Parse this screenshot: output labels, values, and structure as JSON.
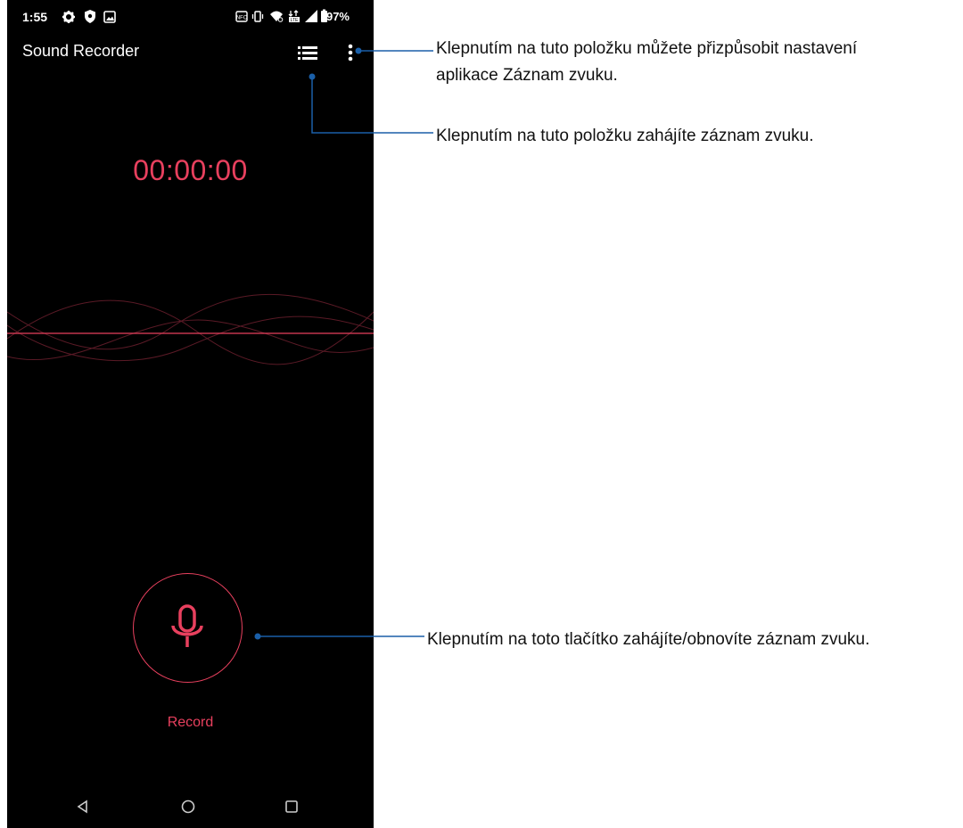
{
  "status_bar": {
    "time": "1:55",
    "battery": "97%",
    "icons": [
      "gear-icon",
      "shield-icon",
      "image-icon",
      "nfc-icon",
      "vibrate-icon",
      "wifi-icon",
      "lte-icon",
      "signal-icon",
      "battery-icon"
    ]
  },
  "app": {
    "title": "Sound Recorder",
    "timer": "00:00:00",
    "record_label": "Record",
    "accent": "#e8405e",
    "background": "#000000"
  },
  "callouts": {
    "settings": "Klepnutím na tuto položku můžete přizpůsobit nastavení aplikace Záznam zvuku.",
    "settings_line1": "Klepnutím na tuto položku můžete přizpůsobit nastavení",
    "settings_line2": "aplikace Záznam zvuku.",
    "list": "Klepnutím na tuto položku zahájíte záznam zvuku.",
    "record": "Klepnutím na toto tlačítko zahájíte/obnovíte záznam zvuku.",
    "line_color": "#1a5fa8"
  },
  "nav_bar": {
    "icons": [
      "back-icon",
      "home-icon",
      "recents-icon"
    ]
  }
}
